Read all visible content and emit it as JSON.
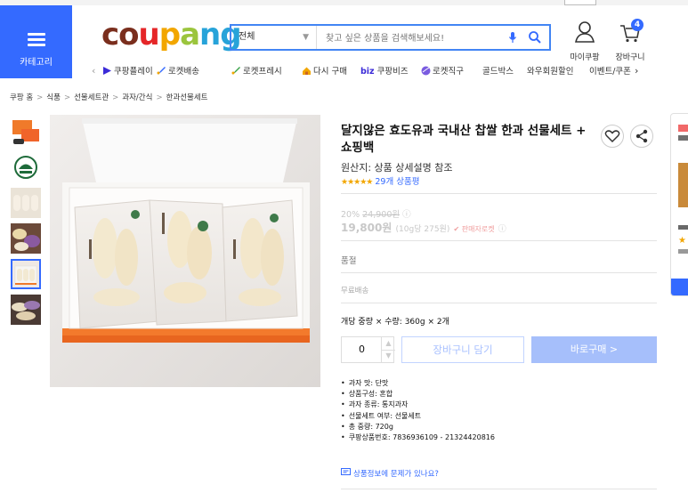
{
  "header": {
    "category_label": "카테고리",
    "logo_letters": [
      {
        "ch": "c",
        "color": "#7a2e1d"
      },
      {
        "ch": "o",
        "color": "#7a2e1d"
      },
      {
        "ch": "u",
        "color": "#e52628"
      },
      {
        "ch": "p",
        "color": "#f2a600"
      },
      {
        "ch": "a",
        "color": "#9bc53d"
      },
      {
        "ch": "n",
        "color": "#27a3d9"
      },
      {
        "ch": "g",
        "color": "#27a3d9"
      }
    ],
    "search": {
      "scope": "전체",
      "placeholder": "찾고 싶은 상품을 검색해보세요!"
    },
    "mypage_label": "마이쿠팡",
    "cart_label": "장바구니",
    "cart_count": "4"
  },
  "nav": {
    "items": [
      "쿠팡플레이",
      "로켓배송",
      "로켓프레시",
      "다시 구매",
      "biz",
      "쿠팡비즈",
      "로켓직구",
      "골드박스",
      "와우회원할인",
      "이벤트/쿠폰"
    ]
  },
  "breadcrumb": [
    "쿠팡 홈",
    "식품",
    "선물세트관",
    "과자/간식",
    "한과선물세트"
  ],
  "product": {
    "title": "달지않은 효도유과 국내산 찹쌀 한과 선물세트 + 쇼핑백",
    "origin": "원산지: 상품 상세설명 참조",
    "stars": "★★★★★",
    "review_count": "29개 상품평",
    "discount_rate": "20%",
    "original_price": "24,900원",
    "price": "19,800원",
    "unit_price": "(10g당 275원)",
    "lowest_label": "✔ 판매자로켓",
    "sold_out": "품절",
    "free_shipping": "무료배송",
    "quantity_info": "개당 중량 × 수량: 360g × 2개",
    "quantity": "0",
    "cart_button": "장바구니 담기",
    "buy_button": "바로구매 >",
    "attributes": [
      "과자 맛: 단맛",
      "상품구성: 혼합",
      "과자 종류: 통지과자",
      "선물세트 여부: 선물세트",
      "총 중량: 720g",
      "쿠팡상품번호: 7836936109 - 21324420816"
    ],
    "report_link": "상품정보에 문제가 있나요?"
  },
  "colors": {
    "accent": "#346aff",
    "buy_disabled": "#a6bffb",
    "star": "#f2a600"
  }
}
